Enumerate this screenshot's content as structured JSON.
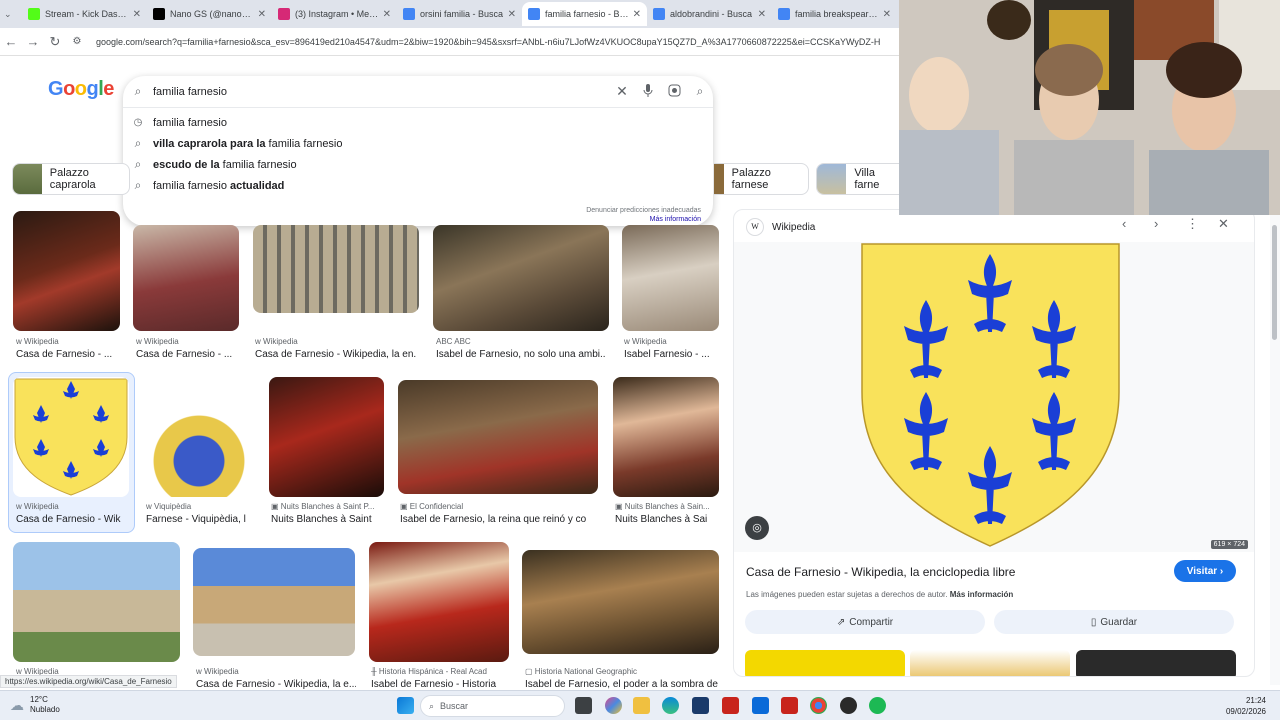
{
  "browser": {
    "tabs": [
      {
        "label": "Stream - Kick Dashbo",
        "color": "#53fc18"
      },
      {
        "label": "Nano GS (@nanogs...",
        "color": "#000000"
      },
      {
        "label": "(3) Instagram • Mens",
        "color": "#d62976"
      },
      {
        "label": "orsini familia - Busca",
        "color": "#4285f4"
      },
      {
        "label": "familia farnesio - Bus",
        "color": "#4285f4"
      },
      {
        "label": "aldobrandini - Busca",
        "color": "#4285f4"
      },
      {
        "label": "familia breakspear - I",
        "color": "#4285f4"
      }
    ],
    "url": "google.com/search?q=familia+farnesio&sca_esv=896419ed210a4547&udm=2&biw=1920&bih=945&sxsrf=ANbL-n6iu7LJofWz4VKUOC8upaY15QZ7D_A%3A1770660872225&ei=CCSKaYWyDZ-H"
  },
  "search": {
    "logo": "Google",
    "value": "familia farnesio",
    "suggestions": [
      {
        "bold": "",
        "rest": "familia farnesio",
        "type": "history"
      },
      {
        "bold": "villa caprarola para la",
        "rest": "familia farnesio",
        "type": "search"
      },
      {
        "bold": "escudo de la",
        "rest": "familia farnesio",
        "type": "search"
      },
      {
        "bold": "",
        "rest": "familia farnesio",
        "suffix": "actualidad",
        "type": "search"
      }
    ],
    "report_line1": "Denunciar predicciones inadecuadas",
    "report_line2": "Más información"
  },
  "chips": [
    {
      "label": "Palazzo caprarola"
    },
    {
      "label": "Palazzo farnese"
    },
    {
      "label": "Villa farne"
    }
  ],
  "results": [
    {
      "source": "Wikipedia",
      "title": "Casa de Farnesio - ..."
    },
    {
      "source": "Wikipedia",
      "title": "Casa de Farnesio - ..."
    },
    {
      "source": "Wikipedia",
      "title": "Casa de Farnesio - Wikipedia, la en..."
    },
    {
      "source": "ABC",
      "title": "Isabel de Farnesio, no solo una ambi..."
    },
    {
      "source": "Wikipedia",
      "title": "Isabel Farnesio - ..."
    },
    {
      "source": "Wikipedia",
      "title": "Casa de Farnesio - Wik"
    },
    {
      "source": "Viquipèdia",
      "title": "Farnese - Viquipèdia, l"
    },
    {
      "source": "Nuits Blanches à Saint P...",
      "title": "Nuits Blanches à Saint"
    },
    {
      "source": "El Confidencial",
      "title": "Isabel de Farnesio, la reina que reinó y co"
    },
    {
      "source": "Nuits Blanches à Sain...",
      "title": "Nuits Blanches à Sai"
    },
    {
      "source": "Wikipedia",
      "title": ""
    },
    {
      "source": "Wikipedia",
      "title": "Casa de Farnesio - Wikipedia, la e..."
    },
    {
      "source": "Historia Hispánica - Real Acad",
      "title": "Isabel de Farnesio - Historia"
    },
    {
      "source": "Historia National Geographic",
      "title": "Isabel de Farnesio, el poder a la sombra de"
    }
  ],
  "panel": {
    "source": "Wikipedia",
    "dimensions": "619 × 724",
    "title": "Casa de Farnesio - Wikipedia, la enciclopedia libre",
    "visit": "Visitar",
    "note": "Las imágenes pueden estar sujetas a derechos de autor.",
    "note_link": "Más información",
    "share": "Compartir",
    "save": "Guardar",
    "colors": {
      "shield": "#f9e25b",
      "lily": "#1a3fd6"
    }
  },
  "status_url": "https://es.wikipedia.org/wiki/Casa_de_Farnesio",
  "taskbar": {
    "temp": "12°C",
    "weather": "Nublado",
    "search": "Buscar",
    "time": "21:24",
    "date": "09/02/2026"
  }
}
